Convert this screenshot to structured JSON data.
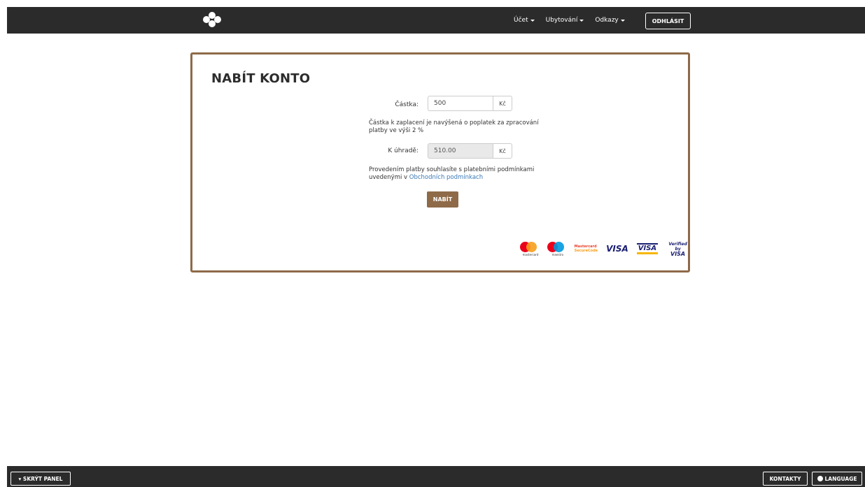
{
  "nav": {
    "account": "Účet",
    "accommodation": "Ubytování",
    "links": "Odkazy",
    "logout": "ODHLÁSIT"
  },
  "card": {
    "title": "NABÍT KONTO",
    "amount_label": "Částka:",
    "amount_value": "500",
    "currency": "Kč",
    "fee_note": "Částka k zaplacení je navýšená o poplatek za zpracování platby ve výši 2 %",
    "due_label": "K úhradě:",
    "due_value": "510.00",
    "terms_text": "Provedením platby souhlasíte s platebními podmínkami uvedenými v",
    "terms_link": "Obchodních podmínkach",
    "pay_button": "NABÍT",
    "payment_logos": {
      "mastercard": "mastercard",
      "maestro": "maestro",
      "mc_securecode_1": "Mastercard",
      "mc_securecode_2": "SecureCode",
      "visa": "VISA",
      "visa_electron": "VISA",
      "verified_1": "Verified by",
      "verified_2": "VISA"
    }
  },
  "footer": {
    "hide_panel": "▾ SKRÝT PANEL",
    "contacts": "KONTAKTY",
    "language": "LANGUAGE"
  },
  "colors": {
    "navbar": "#2b2b2b",
    "accent": "#8e6a48",
    "link": "#3a79b8"
  }
}
